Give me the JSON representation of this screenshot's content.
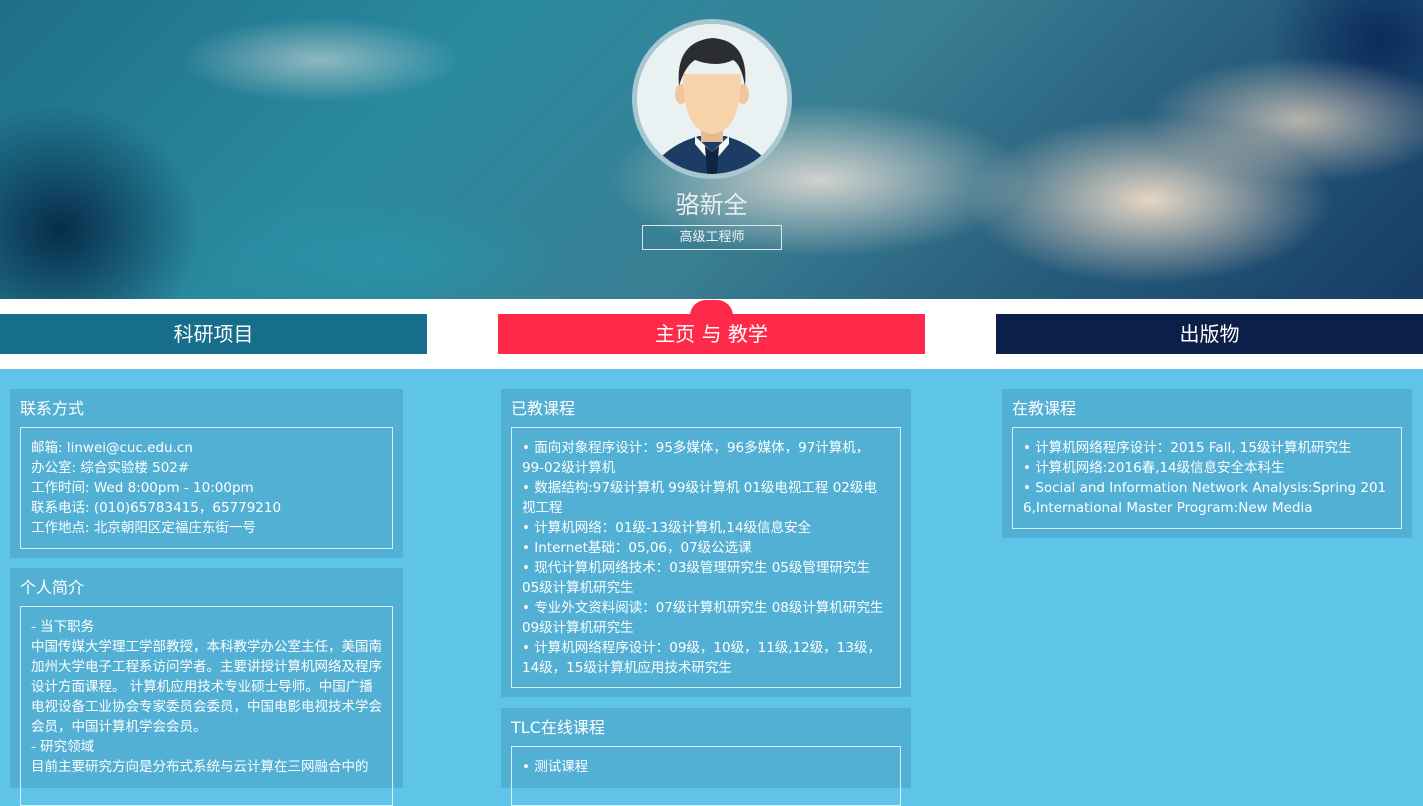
{
  "profile": {
    "name": "骆新全",
    "title": "高级工程师"
  },
  "nav": {
    "tabs": [
      {
        "label": "科研项目"
      },
      {
        "label": "主页 与 教学"
      },
      {
        "label": "出版物"
      }
    ]
  },
  "contact": {
    "title": "联系方式",
    "lines": [
      "邮箱: linwei@cuc.edu.cn",
      "办公室: 综合实验楼 502#",
      "工作时间: Wed 8:00pm - 10:00pm",
      "联系电话: (010)65783415，65779210",
      "工作地点: 北京朝阳区定福庄东街一号"
    ]
  },
  "bio": {
    "title": "个人简介",
    "lines": [
      "- 当下职务",
      "中国传媒大学理工学部教授，本科教学办公室主任，美国南加州大学电子工程系访问学者。主要讲授计算机网络及程序设计方面课程。 计算机应用技术专业硕士导师。中国广播电视设备工业协会专家委员会委员，中国电影电视技术学会会员，中国计算机学会会员。",
      "- 研究领域",
      "目前主要研究方向是分布式系统与云计算在三网融合中的"
    ]
  },
  "taught": {
    "title": "已教课程",
    "items": [
      "• 面向对象程序设计：95多媒体，96多媒体，97计算机，99-02级计算机",
      "• 数据结构:97级计算机 99级计算机 01级电视工程 02级电视工程",
      "• 计算机网络：01级-13级计算机,14级信息安全",
      "• Internet基础：05,06，07级公选课",
      "• 现代计算机网络技术：03级管理研究生 05级管理研究生 05级计算机研究生",
      "• 专业外文资料阅读：07级计算机研究生 08级计算机研究生 09级计算机研究生",
      "• 计算机网络程序设计：09级，10级，11级,12级，13级，14级，15级计算机应用技术研究生"
    ]
  },
  "tlc": {
    "title": "TLC在线课程",
    "items": [
      "• 测试课程"
    ]
  },
  "teaching": {
    "title": "在教课程",
    "items": [
      "• 计算机网络程序设计：2015 Fall, 15级计算机研究生",
      "• 计算机网络:2016春,14级信息安全本科生",
      "• Social and Information Network Analysis:Spring 2016,International Master Program:New Media"
    ]
  }
}
